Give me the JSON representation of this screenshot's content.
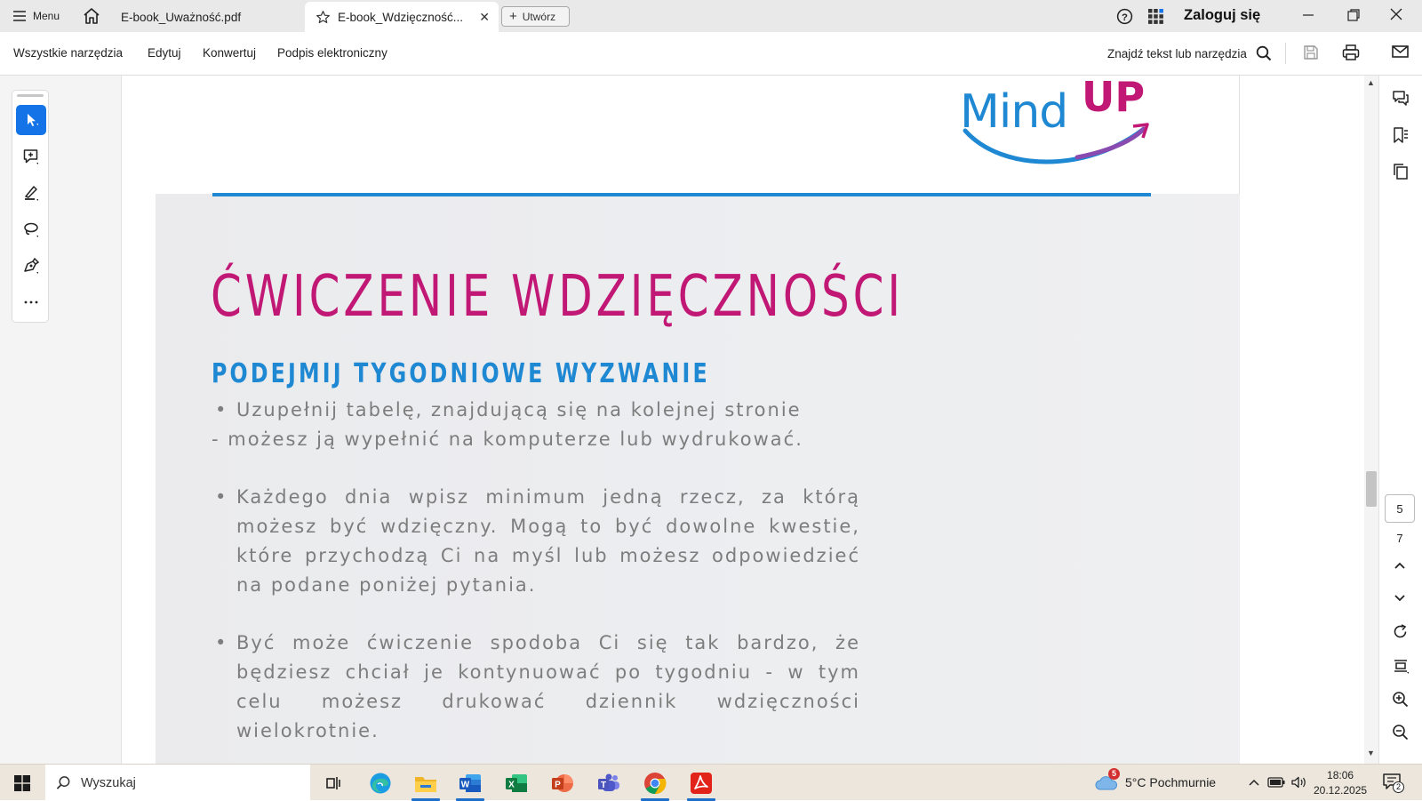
{
  "app": {
    "menu_label": "Menu",
    "tabs": [
      {
        "label": "E-book_Uważność.pdf",
        "active": false
      },
      {
        "label": "E-book_Wdzięczność...",
        "active": true
      }
    ],
    "create_label": "Utwórz",
    "signin_label": "Zaloguj się"
  },
  "toolbar": {
    "items": [
      "Wszystkie narzędzia",
      "Edytuj",
      "Konwertuj",
      "Podpis elektroniczny"
    ],
    "find_label": "Znajdź tekst lub narzędzia"
  },
  "left_tools": [
    "select-tool",
    "add-comment-tool",
    "highlight-tool",
    "lasso-draw-tool",
    "fill-sign-tool",
    "more-tools"
  ],
  "document": {
    "logo_text": "Mind UP",
    "title": "ĆWICZENIE WDZIĘCZNOŚCI",
    "subtitle": "PODEJMIJ TYGODNIOWE WYZWANIE",
    "para1_line1": "Uzupełnij tabelę, znajdującą się na kolejnej stronie",
    "para1_line2": "- możesz ją wypełnić na komputerze lub wydrukować.",
    "para2": "Każdego dnia wpisz minimum jedną rzecz, za którą możesz być wdzięczny. Mogą to być dowolne kwestie, które przychodzą Ci na myśl lub możesz odpowiedzieć na podane poniżej pytania.",
    "para3": "Być może ćwiczenie spodoba Ci się tak bardzo, że będziesz chciał je kontynuować po tygodniu - w tym celu możesz drukować dziennik wdzięczności wielokrotnie.",
    "bullet": "•"
  },
  "pagination": {
    "current": "5",
    "total": "7"
  },
  "taskbar": {
    "search_placeholder": "Wyszukaj",
    "weather_badge": "5",
    "weather_text": "5°C  Pochmurnie",
    "time": "18:06",
    "date": "20.12.2025",
    "notification_count": "2"
  },
  "colors": {
    "accent_blue": "#1473e6",
    "title_magenta": "#c21875",
    "subtitle_blue": "#1e88d3",
    "body_grey": "#7d7d7d"
  }
}
